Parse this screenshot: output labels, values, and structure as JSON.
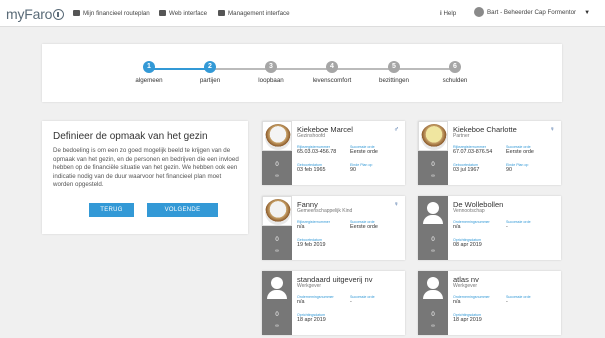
{
  "brand": "myFaro",
  "nav": {
    "routeplan": "Mijn financieel routeplan",
    "web": "Web interface",
    "management": "Management interface",
    "help": "Help",
    "user": "Bart - Beheerder Cap Formentor"
  },
  "steps": [
    {
      "num": "1",
      "label": "algemeen",
      "active": true
    },
    {
      "num": "2",
      "label": "partijen",
      "active": true
    },
    {
      "num": "3",
      "label": "loopbaan",
      "active": false
    },
    {
      "num": "4",
      "label": "levenscomfort",
      "active": false
    },
    {
      "num": "5",
      "label": "bezittingen",
      "active": false
    },
    {
      "num": "6",
      "label": "schulden",
      "active": false
    }
  ],
  "intro": {
    "title": "Definieer de opmaak van het gezin",
    "text": "De bedoeling is om een zo goed mogelijk beeld te krijgen van de opmaak van het gezin, en de personen en bedrijven die een invloed hebben op de financiële situatie van het gezin. We hebben ook een indicatie nodig van de duur waarvoor het financieel plan moet worden opgesteld.",
    "back": "TERUG",
    "next": "VOLGENDE"
  },
  "cards": [
    {
      "name": "Kiekeboe Marcel",
      "role": "Gezinshoofd",
      "gender": "♂",
      "count": "0",
      "avatar": "photo",
      "l1": "Rijksregisternummer",
      "v1": "65.03.03-456.78",
      "l2": "Successie orde",
      "v2": "Eerste orde",
      "l3": "Geboortedatum",
      "v3": "03 feb 1965",
      "l4": "Einde Plan op",
      "v4": "90"
    },
    {
      "name": "Kiekeboe Charlotte",
      "role": "Partner",
      "gender": "♀",
      "count": "0",
      "avatar": "photo",
      "l1": "Rijksregisternummer",
      "v1": "67.07.03-876.54",
      "l2": "Successie orde",
      "v2": "Eerste orde",
      "l3": "Geboortedatum",
      "v3": "03 jul 1967",
      "l4": "Einde Plan op",
      "v4": "90"
    },
    {
      "name": "Fanny",
      "role": "Gemeenschappelijk Kind",
      "gender": "♀",
      "count": "0",
      "avatar": "photo",
      "l1": "Rijksregisternummer",
      "v1": "n/a",
      "l2": "Successie orde",
      "v2": "Eerste orde",
      "l3": "Geboortedatum",
      "v3": "19 feb 2019",
      "l4": "",
      "v4": ""
    },
    {
      "name": "De Wollebollen",
      "role": "Vennootschap",
      "gender": "",
      "count": "0",
      "avatar": "generic",
      "l1": "Ondernemingsnummer",
      "v1": "n/a",
      "l2": "Successie orde",
      "v2": "-",
      "l3": "Oprichtingsdatum",
      "v3": "08 apr 2019",
      "l4": "",
      "v4": ""
    },
    {
      "name": "standaard uitgeverij nv",
      "role": "Werkgever",
      "gender": "",
      "count": "0",
      "avatar": "generic",
      "l1": "Ondernemingsnummer",
      "v1": "n/a",
      "l2": "Successie orde",
      "v2": "-",
      "l3": "Oprichtingsdatum",
      "v3": "18 apr 2019",
      "l4": "",
      "v4": ""
    },
    {
      "name": "atlas nv",
      "role": "Werkgever",
      "gender": "",
      "count": "0",
      "avatar": "generic",
      "l1": "Ondernemingsnummer",
      "v1": "n/a",
      "l2": "Successie orde",
      "v2": "-",
      "l3": "Oprichtingsdatum",
      "v3": "18 apr 2019",
      "l4": "",
      "v4": ""
    }
  ]
}
